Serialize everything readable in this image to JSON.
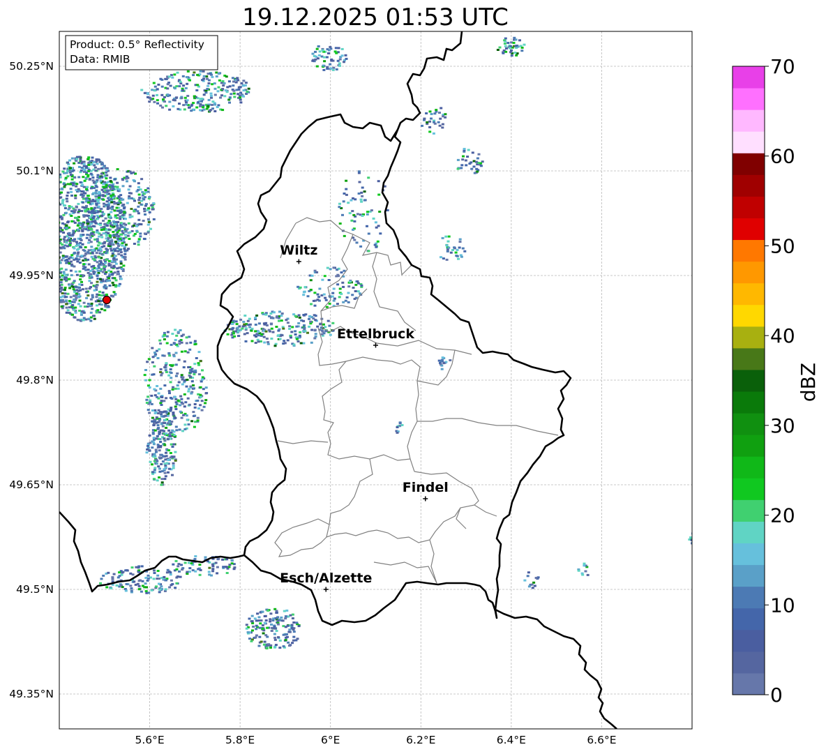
{
  "title": "19.12.2025 01:53 UTC",
  "info_box": {
    "product": "Product: 0.5° Reflectivity",
    "data_source": "Data: RMIB"
  },
  "axes": {
    "x_ticks": [
      "5.6°E",
      "5.8°E",
      "6°E",
      "6.2°E",
      "6.4°E",
      "6.6°E"
    ],
    "y_ticks": [
      "50.25°N",
      "50.1°N",
      "49.95°N",
      "49.8°N",
      "49.65°N",
      "49.5°N",
      "49.35°N"
    ],
    "lon_range": [
      5.4,
      6.8
    ],
    "lat_range": [
      49.3,
      50.3
    ],
    "grid": true
  },
  "cities": [
    {
      "name": "Wiltz",
      "lon": 5.93,
      "lat": 49.97
    },
    {
      "name": "Ettelbruck",
      "lon": 6.1,
      "lat": 49.85
    },
    {
      "name": "Findel",
      "lon": 6.21,
      "lat": 49.63
    },
    {
      "name": "Esch/Alzette",
      "lon": 5.99,
      "lat": 49.5
    }
  ],
  "radar_site": {
    "lon": 5.505,
    "lat": 49.915,
    "color": "#e00000"
  },
  "colorbar": {
    "label": "dBZ",
    "ticks": [
      "0",
      "10",
      "20",
      "30",
      "40",
      "50",
      "60",
      "70"
    ],
    "min": 0,
    "max": 70,
    "colors": [
      "#6677aa",
      "#5566a0",
      "#4a5ea0",
      "#4466aa",
      "#4c7ab4",
      "#5aa0c8",
      "#66c0dc",
      "#60d4c4",
      "#40d070",
      "#10c820",
      "#10b818",
      "#10a010",
      "#109010",
      "#0a7a0a",
      "#0a600a",
      "#487818",
      "#a8b010",
      "#ffd800",
      "#ffb800",
      "#ff9800",
      "#ff7800",
      "#e00000",
      "#c00000",
      "#a00000",
      "#800000",
      "#ffdfff",
      "#ffb8ff",
      "#ff70ff",
      "#e840e8"
    ]
  }
}
